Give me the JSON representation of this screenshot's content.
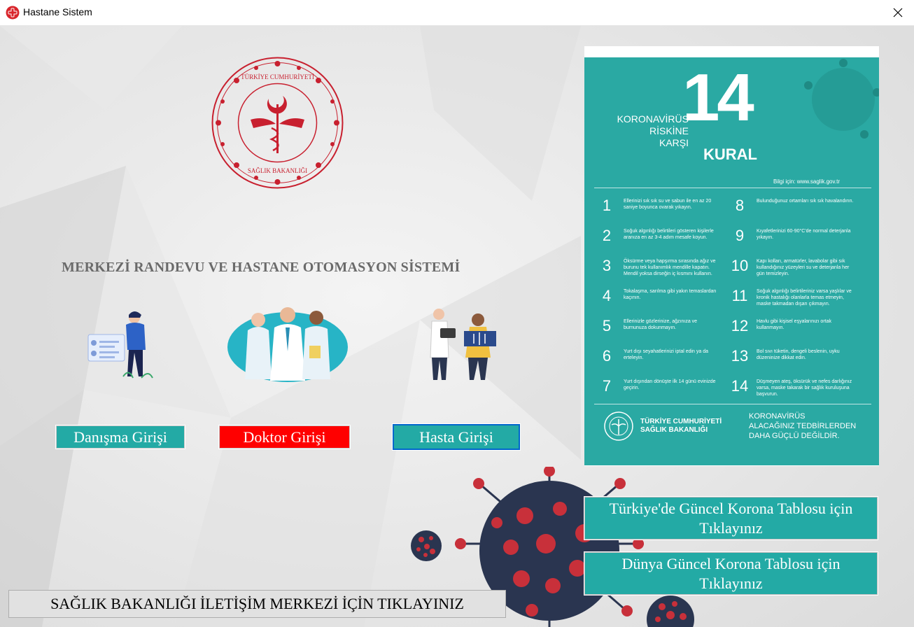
{
  "window": {
    "title": "Hastane Sistem",
    "app_icon": "red-cross-icon",
    "close_icon": "close-icon"
  },
  "main": {
    "heading": "MERKEZİ RANDEVU VE HASTANE OTOMASYON  SİSTEMİ",
    "logo_text": "TÜRKİYE CUMHURİYETİ SAĞLIK BAKANLIĞI",
    "logins": {
      "danisma": "Danışma Girişi",
      "doktor": "Doktor Girişi",
      "hasta": "Hasta Girişi"
    },
    "korona_tr": "Türkiye'de Güncel Korona Tablosu için Tıklayınız",
    "korona_world": "Dünya Güncel Korona Tablosu için Tıklayınız",
    "iletisim": "SAĞLIK BAKANLIĞI İLETİŞİM MERKEZİ İÇİN TIKLAYINIZ"
  },
  "poster": {
    "head_line1": "KORONAVİRÜS",
    "head_line2": "RİSKİNE",
    "head_line3": "KARŞI",
    "big_number": "14",
    "kural": "KURAL",
    "info": "Bilgi için: www.saglik.gov.tr",
    "rules": [
      {
        "num": "1",
        "text": "Ellerinizi sık sık su ve sabun ile en az 20 saniye boyunca ovarak yıkayın."
      },
      {
        "num": "2",
        "text": "Soğuk algınlığı belirtileri gösteren kişilerle aranıza en az 3-4 adım mesafe koyun."
      },
      {
        "num": "3",
        "text": "Öksürme veya hapşırma sırasında ağız ve burunu tek kullanımlık mendille kapatın. Mendil yoksa dirseğin iç kısmını kullanın."
      },
      {
        "num": "4",
        "text": "Tokalaşma, sarılma gibi yakın temaslardan kaçının."
      },
      {
        "num": "5",
        "text": "Ellerinizle gözlerinize, ağzınıza ve burnunuza dokunmayın."
      },
      {
        "num": "6",
        "text": "Yurt dışı seyahatlerinizi iptal edin ya da erteleyin."
      },
      {
        "num": "7",
        "text": "Yurt dışından dönüşte ilk 14 günü evinizde geçirin."
      },
      {
        "num": "8",
        "text": "Bulunduğunuz ortamları sık sık havalandırın."
      },
      {
        "num": "9",
        "text": "Kıyafetlerinizi 60-90°C'de normal deterjanla yıkayın."
      },
      {
        "num": "10",
        "text": "Kapı kolları, armatürler, lavabolar gibi sık kullandığınız yüzeyleri su ve deterjanla her gün temizleyin."
      },
      {
        "num": "11",
        "text": "Soğuk algınlığı belirtileriniz varsa yaşlılar ve kronik hastalığı olanlarla temas etmeyin, maske takmadan dışarı çıkmayın."
      },
      {
        "num": "12",
        "text": "Havlu gibi kişisel eşyalarınızı ortak kullanmayın."
      },
      {
        "num": "13",
        "text": "Bol sıvı tüketin, dengeli beslenin, uyku düzeninize dikkat edin."
      },
      {
        "num": "14",
        "text": "Düşmeyen ateş, öksürük ve nefes darlığınız varsa, maske takarak bir sağlık kuruluşuna başvurun."
      }
    ],
    "footer_left_1": "TÜRKİYE CUMHURİYETİ",
    "footer_left_2": "SAĞLIK BAKANLIĞI",
    "footer_right_1": "KORONAVİRÜS",
    "footer_right_2": "ALACAĞINIZ TEDBİRLERDEN",
    "footer_right_3": "DAHA GÜÇLÜ DEĞİLDİR."
  },
  "colors": {
    "teal": "#23aaa5",
    "red": "#ff0000",
    "logo_red": "#c8202f",
    "virus_red": "#c8303a",
    "virus_navy": "#2a3550"
  }
}
